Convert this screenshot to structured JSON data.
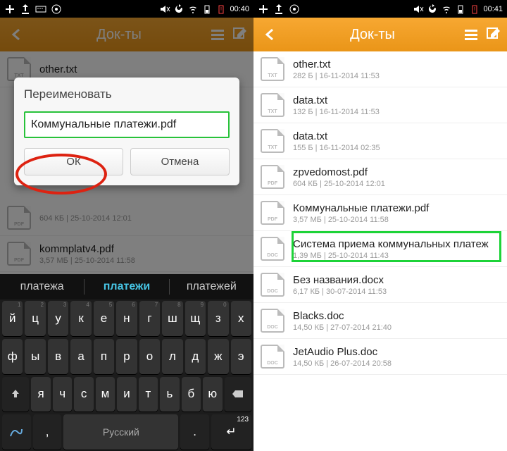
{
  "left": {
    "statusbar": {
      "time": "00:40"
    },
    "header": {
      "title": "Док-ты"
    },
    "files": [
      {
        "name": "other.txt",
        "ext": "TXT",
        "meta": ""
      },
      {
        "name": "",
        "ext": "PDF",
        "meta": "604 КБ | 25-10-2014 12:01"
      },
      {
        "name": "kommplatv4.pdf",
        "ext": "PDF",
        "meta": "3,57 МБ | 25-10-2014 11:58"
      }
    ],
    "dialog": {
      "title": "Переименовать",
      "value": "Коммунальные платежи.pdf",
      "ok": "ОК",
      "cancel": "Отмена"
    },
    "suggestions": [
      "платежа",
      "платежи",
      "платежей"
    ],
    "keyboard": {
      "row1": [
        "й",
        "ц",
        "у",
        "к",
        "е",
        "н",
        "г",
        "ш",
        "щ",
        "з",
        "х"
      ],
      "row1sub": [
        "1",
        "2",
        "3",
        "4",
        "5",
        "6",
        "7",
        "8",
        "9",
        "0",
        ""
      ],
      "row2": [
        "ф",
        "ы",
        "в",
        "а",
        "п",
        "р",
        "о",
        "л",
        "д",
        "ж",
        "э"
      ],
      "row3": [
        "я",
        "ч",
        "с",
        "м",
        "и",
        "т",
        "ь",
        "б",
        "ю"
      ],
      "space": "Русский",
      "enter": "123"
    }
  },
  "right": {
    "statusbar": {
      "time": "00:41"
    },
    "header": {
      "title": "Док-ты"
    },
    "files": [
      {
        "name": "other.txt",
        "ext": "TXT",
        "meta": "282 Б | 16-11-2014 11:53"
      },
      {
        "name": "data.txt",
        "ext": "TXT",
        "meta": "132 Б | 16-11-2014 11:53"
      },
      {
        "name": "data.txt",
        "ext": "TXT",
        "meta": "155 Б | 16-11-2014 02:35"
      },
      {
        "name": "zpvedomost.pdf",
        "ext": "PDF",
        "meta": "604 КБ | 25-10-2014 12:01"
      },
      {
        "name": "Коммунальные платежи.pdf",
        "ext": "PDF",
        "meta": "3,57 МБ | 25-10-2014 11:58"
      },
      {
        "name": "Система приема коммунальных платеж",
        "ext": "DOC",
        "meta": "1,39 МБ | 25-10-2014 11:43"
      },
      {
        "name": "Без названия.docx",
        "ext": "DOC",
        "meta": "6,17 КБ | 30-07-2014 11:53"
      },
      {
        "name": "Blacks.doc",
        "ext": "DOC",
        "meta": "14,50 КБ | 27-07-2014 21:40"
      },
      {
        "name": "JetAudio Plus.doc",
        "ext": "DOC",
        "meta": "14,50 КБ | 26-07-2014 20:58"
      }
    ]
  }
}
